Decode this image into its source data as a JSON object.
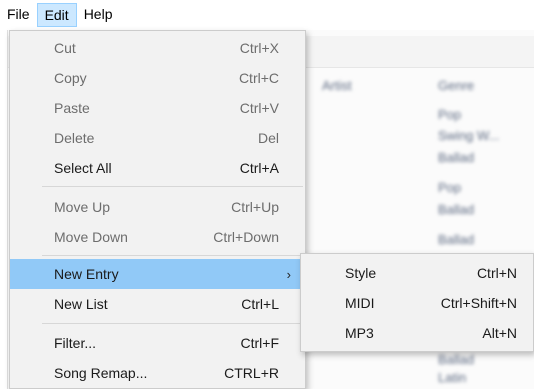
{
  "menubar": {
    "items": [
      {
        "label": "File"
      },
      {
        "label": "Edit"
      },
      {
        "label": "Help"
      }
    ]
  },
  "edit_menu": {
    "items": [
      {
        "label": "Cut",
        "shortcut": "Ctrl+X",
        "enabled": false
      },
      {
        "label": "Copy",
        "shortcut": "Ctrl+C",
        "enabled": false
      },
      {
        "label": "Paste",
        "shortcut": "Ctrl+V",
        "enabled": false
      },
      {
        "label": "Delete",
        "shortcut": "Del",
        "enabled": false
      },
      {
        "label": "Select All",
        "shortcut": "Ctrl+A",
        "enabled": true
      },
      {
        "label": "Move Up",
        "shortcut": "Ctrl+Up",
        "enabled": false
      },
      {
        "label": "Move Down",
        "shortcut": "Ctrl+Down",
        "enabled": false
      },
      {
        "label": "New Entry",
        "shortcut": "",
        "enabled": true,
        "has_submenu": true,
        "highlighted": true
      },
      {
        "label": "New List",
        "shortcut": "Ctrl+L",
        "enabled": true
      },
      {
        "label": "Filter...",
        "shortcut": "Ctrl+F",
        "enabled": true
      },
      {
        "label": "Song Remap...",
        "shortcut": "CTRL+R",
        "enabled": true
      }
    ],
    "submenu_arrow": "›"
  },
  "new_entry_submenu": {
    "items": [
      {
        "label": "Style",
        "shortcut": "Ctrl+N"
      },
      {
        "label": "MIDI",
        "shortcut": "Ctrl+Shift+N"
      },
      {
        "label": "MP3",
        "shortcut": "Alt+N"
      }
    ]
  },
  "background": {
    "column_artist": "Artist",
    "column_genre": "Genre",
    "genres": [
      "Pop",
      "Swing W...",
      "Ballad",
      "Pop",
      "Ballad",
      "Ballad",
      "Ballad",
      "Ballad",
      "Latin"
    ]
  },
  "colors": {
    "menu_bg": "#f2f2f2",
    "highlight": "#91c9f7",
    "menubar_open": "#cce8ff",
    "disabled_text": "#6d6d6d"
  }
}
